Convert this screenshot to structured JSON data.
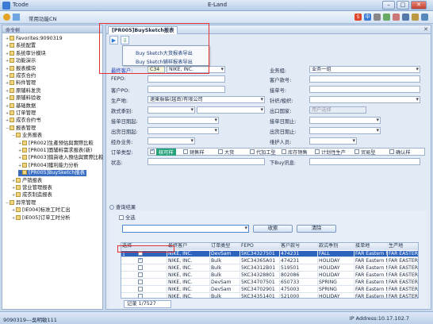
{
  "window": {
    "tcode": "Tcode",
    "title": "E-Land",
    "function_menu": "常用功能CN",
    "min": "–",
    "max": "□",
    "close": "✕"
  },
  "toolbar": {
    "icon_text": "中"
  },
  "sidebar": {
    "title": "命令树",
    "items": [
      {
        "label": "Favorites:9090319",
        "level": 0,
        "expanded": false
      },
      {
        "label": "系统配置",
        "level": 0,
        "expanded": false
      },
      {
        "label": "系统审计模块",
        "level": 0,
        "expanded": false
      },
      {
        "label": "功能演示",
        "level": 0,
        "expanded": false
      },
      {
        "label": "报表模块",
        "level": 0,
        "expanded": false
      },
      {
        "label": "成衣合约",
        "level": 0,
        "expanded": false
      },
      {
        "label": "料件管理",
        "level": 0,
        "expanded": false
      },
      {
        "label": "原辅料发货",
        "level": 0,
        "expanded": false
      },
      {
        "label": "原辅料验收",
        "level": 0,
        "expanded": false
      },
      {
        "label": "基础数据",
        "level": 0,
        "expanded": false
      },
      {
        "label": "订单管理",
        "level": 0,
        "expanded": false
      },
      {
        "label": "成衣合约书",
        "level": 0,
        "expanded": false
      },
      {
        "label": "报表管理",
        "level": 0,
        "expanded": true
      },
      {
        "label": "业务报表",
        "level": 1,
        "expanded": true
      },
      {
        "label": "[PR002]生產预估與實際比較",
        "level": 2,
        "expanded": false
      },
      {
        "label": "[PR001]面辅料需求报表(新)",
        "level": 2,
        "expanded": false
      },
      {
        "label": "[PR003]銷貨收入預估與實際比較",
        "level": 2,
        "expanded": false
      },
      {
        "label": "[PR004]獲利能力分析",
        "level": 2,
        "expanded": false
      },
      {
        "label": "[PR005]BuySketch报表",
        "level": 2,
        "expanded": false,
        "selected": true
      },
      {
        "label": "产销报表",
        "level": 1,
        "expanded": false
      },
      {
        "label": "营业管理报表",
        "level": 1,
        "expanded": false
      },
      {
        "label": "成衣制造报表",
        "level": 1,
        "expanded": false
      },
      {
        "label": "异常管理",
        "level": 0,
        "expanded": true
      },
      {
        "label": "[IE004]标准工时汇出",
        "level": 1,
        "expanded": false
      },
      {
        "label": "[IE005]订单工时分析",
        "level": 1,
        "expanded": false
      }
    ]
  },
  "tab": {
    "label": "[PR005]BuySketch报表",
    "close": "✕"
  },
  "export_menu": {
    "items": [
      "Buy Sketch大货报表导出",
      "Buy Sketch辅样报表导出"
    ]
  },
  "form": {
    "final_customer_label": "最终客户:",
    "final_customer_code": "C34",
    "final_customer_name": "NIKE, INC.",
    "dept_label": "业务组:",
    "dept_value": "业务一组",
    "fepo_label": "FEPO:",
    "customer_no_label": "客户款号:",
    "customer_po_label": "客户PO:",
    "order_no_label": "接单号:",
    "production_label": "生产地:",
    "production_value": "速東服裝(越南)有限公司",
    "knit_label": "针织/梭织:",
    "season_label": "款式季别:",
    "export_country_label": "出口国家:",
    "export_country_placeholder": "用户选择",
    "order_date_label": "接单日期起:",
    "order_date_to_label": "接单日期止:",
    "ship_date_label": "出货日期起:",
    "ship_date_to_label": "出货日期止:",
    "sales_label": "经办业务:",
    "maintainer_label": "维护人员:",
    "ordertype_label": "订单类型:",
    "ordertypes": [
      {
        "label": "核可样",
        "checked": true
      },
      {
        "label": "銷售样",
        "checked": false
      },
      {
        "label": "大货",
        "checked": false
      },
      {
        "label": "代加工型",
        "checked": false
      },
      {
        "label": "库存销售",
        "checked": false
      },
      {
        "label": "计划性生产",
        "checked": false
      },
      {
        "label": "贸易型",
        "checked": false
      },
      {
        "label": "确认样",
        "checked": false
      }
    ],
    "status_label": "状态:",
    "buy_label": "下Buy讯息:"
  },
  "results": {
    "title": "查询结果",
    "select_all": "全选",
    "search_btn": "收索",
    "clear_btn": "清除",
    "columns": [
      "选择",
      "最终客户",
      "订单类型",
      "FEPO",
      "客户款号",
      "款式季别",
      "接单地",
      "生产地"
    ],
    "rows": [
      {
        "n": "1",
        "checked": false,
        "customer": "NIKE, INC.",
        "type": "DevSam",
        "fepo": "5KC34327501",
        "style": "474231",
        "season": "FALL",
        "origin": "FAR Eastern N",
        "factory": "FAR EASTERN.",
        "selected": true
      },
      {
        "n": "",
        "checked": true,
        "customer": "NIKE, INC.",
        "type": "Bulk",
        "fepo": "5KC34365A01",
        "style": "474231",
        "season": "HOLIDAY",
        "origin": "FAR Eastern N",
        "factory": "FAR EASTERN."
      },
      {
        "n": "",
        "checked": false,
        "customer": "NIKE, INC.",
        "type": "Bulk",
        "fepo": "5KC34312B01",
        "style": "519501",
        "season": "HOLIDAY",
        "origin": "FAR Eastern N",
        "factory": "FAR EASTERN."
      },
      {
        "n": "",
        "checked": false,
        "customer": "NIKE, INC.",
        "type": "Bulk",
        "fepo": "5KC34328801",
        "style": "802086",
        "season": "HOLIDAY",
        "origin": "FAR Eastern N",
        "factory": "FAR EASTERN."
      },
      {
        "n": "",
        "checked": false,
        "customer": "NIKE, INC.",
        "type": "DevSam",
        "fepo": "5KC34707501",
        "style": "650733",
        "season": "SPRING",
        "origin": "FAR Eastern N",
        "factory": "FAR EASTERN."
      },
      {
        "n": "",
        "checked": false,
        "customer": "NIKE, INC.",
        "type": "DevSam",
        "fepo": "5KC34702901",
        "style": "475003",
        "season": "SPRING",
        "origin": "FAR Eastern N",
        "factory": "FAR EASTERN."
      },
      {
        "n": "",
        "checked": false,
        "customer": "NIKE, INC.",
        "type": "Bulk",
        "fepo": "5KC34351401",
        "style": "521000",
        "season": "HOLIDAY",
        "origin": "FAR Eastern N",
        "factory": "FAR EASTERN."
      }
    ],
    "pager": "记录 1/7527"
  },
  "status": {
    "left": "9090319---吳明敏111",
    "right": "IP Address:10.17.102.7"
  },
  "colors": {
    "accent": "#2c63bd",
    "highlight": "#27a37c",
    "callout": "#e23030"
  }
}
